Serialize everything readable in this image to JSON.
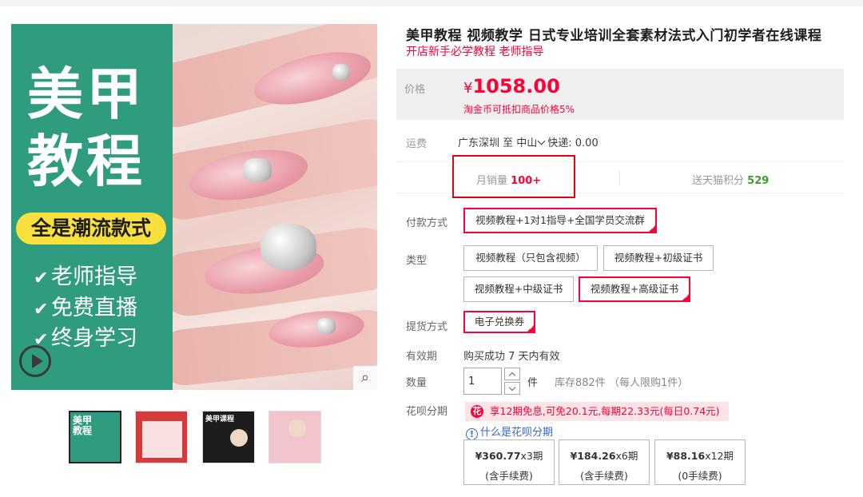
{
  "product": {
    "title": "美甲教程 视频教学 日式专业培训全套素材法式入门初学者在线课程",
    "subtitle": "开店新手必学教程 老师指导"
  },
  "gallery": {
    "main_image": {
      "title_line1": "美甲",
      "title_line2": "教程",
      "badge": "全是潮流款式",
      "features": [
        "老师指导",
        "免费直播",
        "终身学习"
      ]
    },
    "thumbnails": [
      {
        "label": "美甲\n教程"
      },
      {
        "label": ""
      },
      {
        "label": "美甲课程"
      },
      {
        "label": ""
      }
    ]
  },
  "price": {
    "label": "价格",
    "currency": "¥",
    "amount": "1058.00",
    "coin_note": "淘金币可抵扣商品价格5%"
  },
  "shipping": {
    "label": "运费",
    "value": "广东深圳  至 中山",
    "express": "快递: 0.00"
  },
  "stats": {
    "monthly_sales_label": "月销量",
    "monthly_sales_value": "100+",
    "points_label": "送天猫积分",
    "points_value": "529"
  },
  "options": {
    "payment_label": "付款方式",
    "payment": [
      "视频教程+1对1指导+全国学员交流群"
    ],
    "type_label": "类型",
    "types": [
      "视频教程（只包含视频）",
      "视频教程+初级证书",
      "视频教程+中级证书",
      "视频教程+高级证书"
    ],
    "delivery_label": "提货方式",
    "delivery": [
      "电子兑换券"
    ],
    "validity_label": "有效期",
    "validity_value": "购买成功 7 天内有效",
    "quantity_label": "数量",
    "quantity_value": "1",
    "unit": "件",
    "stock": "库存882件  （每人限购1件）"
  },
  "huabei": {
    "label": "花呗分期",
    "promo": "享12期免息,可免20.1元,每期22.33元(每日0.74元)",
    "what_link": "什么是花呗分期",
    "plans": [
      {
        "amount": "¥360.77",
        "periods": "x3期",
        "fee": "(含手续费)"
      },
      {
        "amount": "¥184.26",
        "periods": "x6期",
        "fee": "(含手续费)"
      },
      {
        "amount": "¥88.16",
        "periods": "x12期",
        "fee": "(0手续费)"
      }
    ]
  },
  "colors": {
    "accent": "#ff0036",
    "brand_green": "#2f9c80",
    "badge_yellow": "#f9e03d",
    "points_green": "#3a9c31"
  },
  "icons": {
    "play": "play-circle-icon",
    "zoom": "magnifier-icon",
    "check": "checkmark-icon",
    "info": "info-circle-icon",
    "huabei": "huabei-logo-icon",
    "chevron": "chevron-down-icon"
  }
}
